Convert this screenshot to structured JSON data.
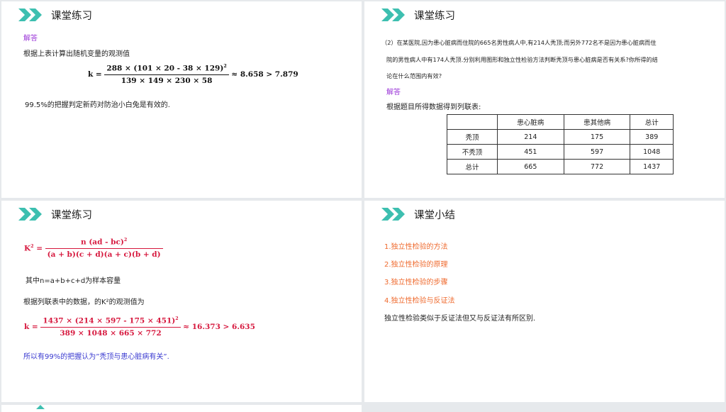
{
  "slides": [
    {
      "title": "课堂练习",
      "answer_label": "解答",
      "line1": "根据上表计算出随机变量的观测值",
      "formula": {
        "lhs": "k =",
        "numerator": "288 × (101 × 20 - 38 × 129)",
        "numerator_power": "2",
        "denominator": "139 × 149 × 230 × 58",
        "result": "≈ 8.658 > 7.879"
      },
      "conclusion": "99.5%的把握判定新药对防治小白兔是有效的."
    },
    {
      "title": "课堂练习",
      "question_line1": "（2）在某医院,因为患心脏病而住院的665名男性病人中,有214人秃顶;而另外772名不是因为患心脏病而住",
      "question_line2": "院的男性病人中有174人秃顶.分别利用图形和独立性检验方法判断秃顶与患心脏病是否有关系?你所得的结",
      "question_line3": "论在什么范围内有效?",
      "answer_label": "解答",
      "line1": "根据题目所得数据得到列联表:",
      "table": {
        "headers": [
          "",
          "患心脏病",
          "患其他病",
          "总计"
        ],
        "rows": [
          [
            "秃顶",
            "214",
            "175",
            "389"
          ],
          [
            "不秃顶",
            "451",
            "597",
            "1048"
          ],
          [
            "总计",
            "665",
            "772",
            "1437"
          ]
        ]
      }
    },
    {
      "title": "课堂练习",
      "k2_formula": {
        "lhs": "K",
        "lhs_power": "2",
        "eq": "=",
        "numerator": "n (ad - bc)",
        "numerator_power": "2",
        "denominator": "(a + b)(c + d)(a + c)(b + d)"
      },
      "note": "其中n=a+b+c+d为样本容量",
      "line2": "根据列联表中的数据，的K²的观测值为",
      "k_formula": {
        "lhs": "k =",
        "numerator": "1437 × (214 × 597 - 175 × 451)",
        "numerator_power": "2",
        "denominator": "389 × 1048 × 665 × 772",
        "result": "≈ 16.373 > 6.635"
      },
      "conclusion": "所以有99%的把握认为”秃顶与患心脏病有关”."
    },
    {
      "title": "课堂小结",
      "items": [
        "1.独立性检验的方法",
        "2.独立性检验的原理",
        "3.独立性检验的步骤",
        "4.独立性检验与反证法"
      ],
      "summary": "独立性检验类似于反证法但又与反证法有所区别."
    }
  ],
  "colors": {
    "accent": "#3dbfb0",
    "purple": "#9b37d8",
    "orange": "#ef6a2e",
    "red": "#d6173d",
    "blue": "#3a3ad0"
  }
}
